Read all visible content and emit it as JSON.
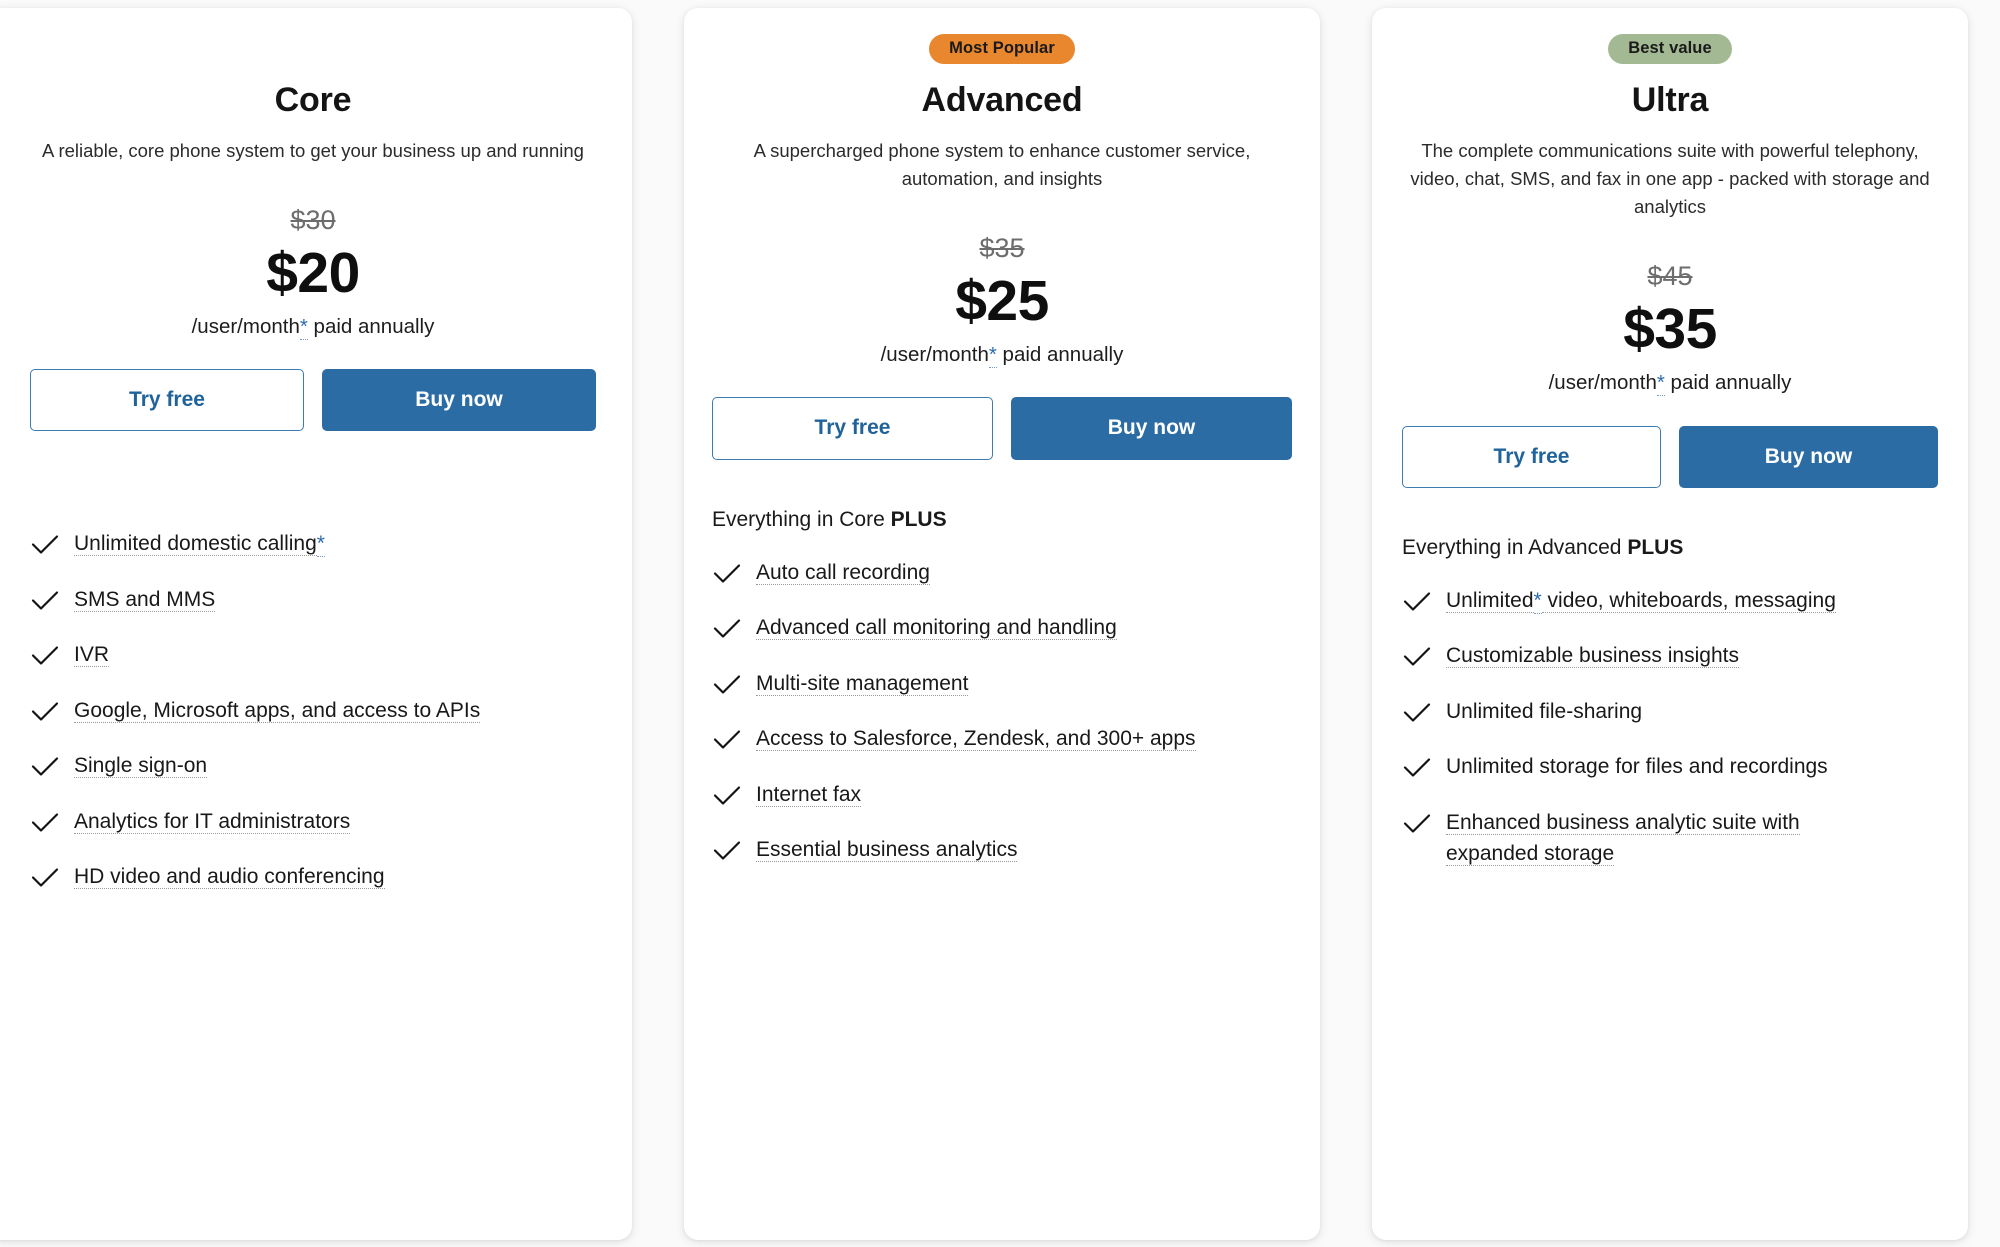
{
  "colors": {
    "page_background": "#fafafa",
    "card_background": "#ffffff",
    "primary_button": "#2c6ca5",
    "outline_button_text": "#20639b",
    "badge_popular": "#e8872e",
    "badge_value": "#a3b993",
    "asterisk_link": "#2b6cb0",
    "old_price": "#6d6d6d"
  },
  "plans": [
    {
      "badge": "",
      "name": "Core",
      "description": "A reliable, core phone system to get your business up and running",
      "price_old": "$30",
      "price_now": "$20",
      "terms_prefix": "/user/month",
      "asterisk": "*",
      "terms_suffix": "paid annually",
      "try_label": "Try free",
      "buy_label": "Buy now",
      "everything_prefix": "",
      "everything_bold": "",
      "features": [
        {
          "text": "Unlimited domestic calling",
          "asterisk": "*",
          "tooltip": true
        },
        {
          "text": "SMS and MMS",
          "tooltip": true
        },
        {
          "text": "IVR",
          "tooltip": true
        },
        {
          "text": "Google, Microsoft apps, and access to APIs",
          "tooltip": true
        },
        {
          "text": "Single sign-on",
          "tooltip": true
        },
        {
          "text": "Analytics for IT administrators",
          "tooltip": true
        },
        {
          "text": "HD video and audio conferencing",
          "tooltip": true
        }
      ]
    },
    {
      "badge": "Most Popular",
      "name": "Advanced",
      "description": "A supercharged phone system to enhance customer service, automation, and insights",
      "price_old": "$35",
      "price_now": "$25",
      "terms_prefix": "/user/month",
      "asterisk": "*",
      "terms_suffix": "paid annually",
      "try_label": "Try free",
      "buy_label": "Buy now",
      "everything_prefix": "Everything in Core ",
      "everything_bold": "PLUS",
      "features": [
        {
          "text": "Auto call recording",
          "tooltip": true
        },
        {
          "text": "Advanced call monitoring and handling",
          "tooltip": true
        },
        {
          "text": "Multi-site management",
          "tooltip": true
        },
        {
          "text": "Access to Salesforce, Zendesk, and 300+ apps",
          "tooltip": true
        },
        {
          "text": "Internet fax",
          "tooltip": true
        },
        {
          "text": "Essential business analytics",
          "tooltip": true
        }
      ]
    },
    {
      "badge": "Best value",
      "name": "Ultra",
      "description": "The complete communications suite with powerful telephony, video, chat, SMS, and fax in one app - packed with storage and analytics",
      "price_old": "$45",
      "price_now": "$35",
      "terms_prefix": "/user/month",
      "asterisk": "*",
      "terms_suffix": "paid annually",
      "try_label": "Try free",
      "buy_label": "Buy now",
      "everything_prefix": "Everything in Advanced ",
      "everything_bold": "PLUS",
      "features": [
        {
          "text_before_asterisk": "Unlimited",
          "asterisk": "*",
          "text": " video, whiteboards, messaging",
          "tooltip": true
        },
        {
          "text": "Customizable business insights",
          "tooltip": true
        },
        {
          "text": "Unlimited file-sharing",
          "tooltip": false
        },
        {
          "text": "Unlimited storage for files and recordings",
          "tooltip": false
        },
        {
          "text": "Enhanced business analytic suite with expanded storage",
          "tooltip": true
        }
      ]
    }
  ]
}
